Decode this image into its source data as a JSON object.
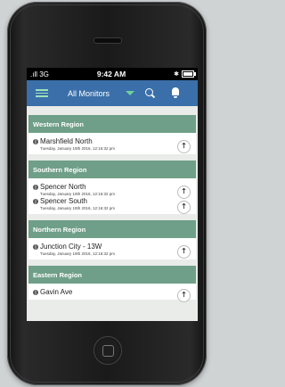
{
  "statusbar": {
    "signal": ".ıll 3G",
    "time": "9:42 AM"
  },
  "appbar": {
    "title": "All Monitors"
  },
  "regions": [
    {
      "name": "Western Region",
      "monitors": [
        {
          "name": "Marshfield North",
          "timestamp": "Tuesday, January 19th 2016, 12:16:32 pm"
        }
      ]
    },
    {
      "name": "Southern Region",
      "monitors": [
        {
          "name": "Spencer North",
          "timestamp": "Tuesday, January 19th 2016, 12:16:32 pm"
        },
        {
          "name": "Spencer South",
          "timestamp": "Tuesday, January 19th 2016, 12:16:32 pm"
        }
      ]
    },
    {
      "name": "Northern Region",
      "monitors": [
        {
          "name": "Junction City - 13W",
          "timestamp": "Tuesday, January 19th 2016, 12:16:32 pm"
        }
      ]
    },
    {
      "name": "Eastern Region",
      "monitors": [
        {
          "name": "Gavin Ave",
          "timestamp": ""
        }
      ]
    }
  ],
  "arrow_glyph": "🡑",
  "colors": {
    "appbar": "#3a6fa9",
    "region_header": "#6f9f88",
    "accent_green": "#6fd19a"
  }
}
